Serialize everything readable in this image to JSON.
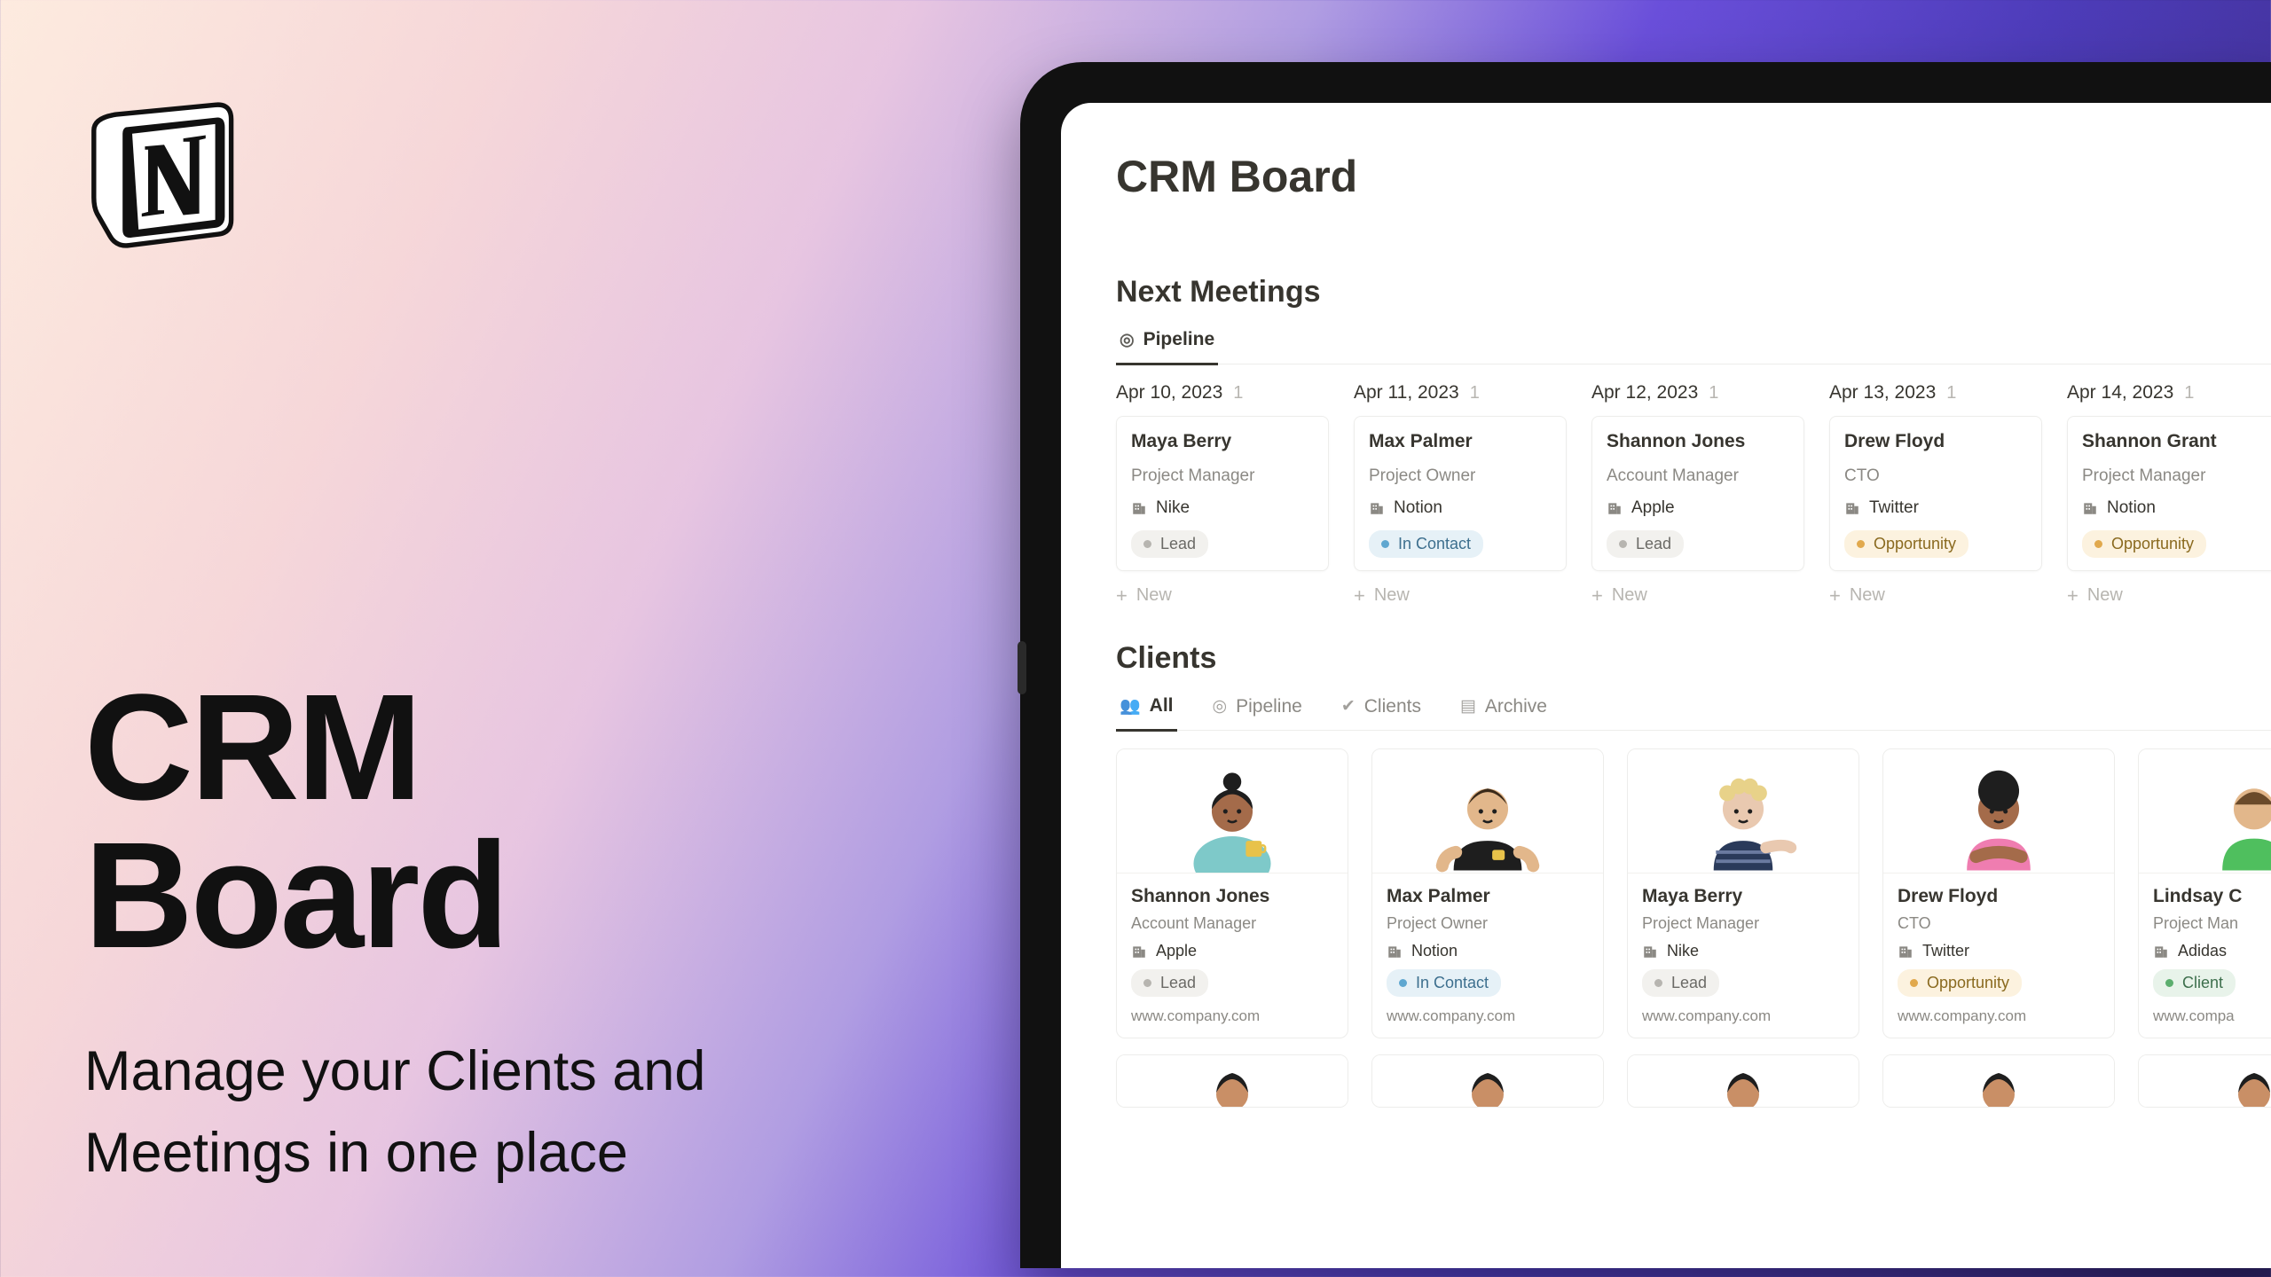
{
  "hero": {
    "title_line1": "CRM",
    "title_line2": "Board",
    "subtitle_line1": "Manage your Clients and",
    "subtitle_line2": "Meetings in one place"
  },
  "page": {
    "title": "CRM Board"
  },
  "meetings": {
    "section_title": "Next Meetings",
    "tab_label": "Pipeline",
    "new_label": "New",
    "columns": [
      {
        "date": "Apr 10, 2023",
        "count": "1",
        "name": "Maya Berry",
        "role": "Project Manager",
        "company": "Nike",
        "status": "Lead",
        "status_class": "lead"
      },
      {
        "date": "Apr 11, 2023",
        "count": "1",
        "name": "Max Palmer",
        "role": "Project Owner",
        "company": "Notion",
        "status": "In Contact",
        "status_class": "contact"
      },
      {
        "date": "Apr 12, 2023",
        "count": "1",
        "name": "Shannon Jones",
        "role": "Account Manager",
        "company": "Apple",
        "status": "Lead",
        "status_class": "lead"
      },
      {
        "date": "Apr 13, 2023",
        "count": "1",
        "name": "Drew Floyd",
        "role": "CTO",
        "company": "Twitter",
        "status": "Opportunity",
        "status_class": "opp"
      },
      {
        "date": "Apr 14, 2023",
        "count": "1",
        "name": "Shannon Grant",
        "role": "Project Manager",
        "company": "Notion",
        "status": "Opportunity",
        "status_class": "opp"
      }
    ]
  },
  "clients": {
    "section_title": "Clients",
    "tabs": [
      {
        "label": "All",
        "icon": "people",
        "active": true
      },
      {
        "label": "Pipeline",
        "icon": "target",
        "active": false
      },
      {
        "label": "Clients",
        "icon": "check",
        "active": false
      },
      {
        "label": "Archive",
        "icon": "archive",
        "active": false
      }
    ],
    "cards": [
      {
        "name": "Shannon Jones",
        "role": "Account Manager",
        "company": "Apple",
        "status": "Lead",
        "status_class": "lead",
        "url": "www.company.com",
        "avatar": 0
      },
      {
        "name": "Max Palmer",
        "role": "Project Owner",
        "company": "Notion",
        "status": "In Contact",
        "status_class": "contact",
        "url": "www.company.com",
        "avatar": 1
      },
      {
        "name": "Maya Berry",
        "role": "Project Manager",
        "company": "Nike",
        "status": "Lead",
        "status_class": "lead",
        "url": "www.company.com",
        "avatar": 2
      },
      {
        "name": "Drew Floyd",
        "role": "CTO",
        "company": "Twitter",
        "status": "Opportunity",
        "status_class": "opp",
        "url": "www.company.com",
        "avatar": 3
      },
      {
        "name": "Lindsay C",
        "role": "Project Man",
        "company": "Adidas",
        "status": "Client",
        "status_class": "client",
        "url": "www.compa",
        "avatar": 4
      }
    ]
  }
}
